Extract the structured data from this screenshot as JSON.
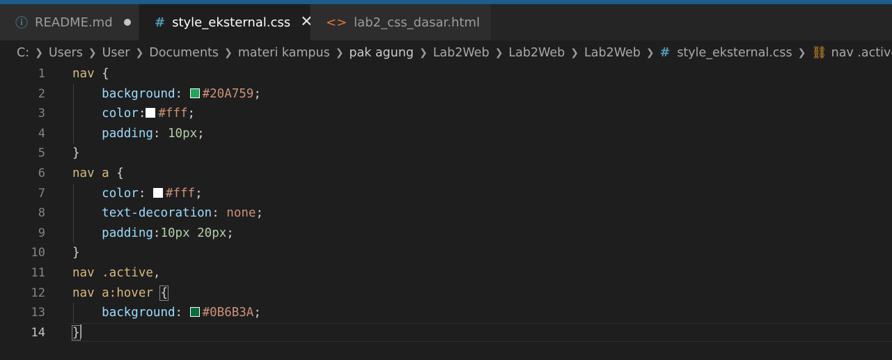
{
  "tabs": [
    {
      "label": "README.md",
      "icon": "info-icon",
      "modified": true,
      "active": false
    },
    {
      "label": "style_eksternal.css",
      "icon": "css-hash-icon",
      "active": true
    },
    {
      "label": "lab2_css_dasar.html",
      "icon": "html-code-icon",
      "active": false
    }
  ],
  "breadcrumb": [
    "C:",
    "Users",
    "User",
    "Documents",
    "materi kampus",
    "pak agung",
    "Lab2Web",
    "Lab2Web",
    "Lab2Web",
    "style_eksternal.css",
    "nav .active"
  ],
  "colors": {
    "swatch_green": "#20A759",
    "swatch_white": "#ffffff",
    "swatch_dark_green": "#0B6B3A",
    "accent_strip": "#1c5d8c"
  },
  "code": {
    "line_numbers": [
      "1",
      "2",
      "3",
      "4",
      "5",
      "6",
      "7",
      "8",
      "9",
      "10",
      "11",
      "12",
      "13",
      "14"
    ],
    "l1_sel": "nav",
    "l1_brace": " {",
    "l2_prop": "background",
    "l2_colon": ": ",
    "l2_val": "#20A759",
    "l2_semi": ";",
    "l3_prop": "color",
    "l3_colon": ":",
    "l3_val": "#fff",
    "l3_semi": ";",
    "l4_prop": "padding",
    "l4_colon": ": ",
    "l4_val": "10px",
    "l4_semi": ";",
    "l5_brace": "}",
    "l6_sel": "nav a",
    "l6_brace": " {",
    "l7_prop": "color",
    "l7_colon": ": ",
    "l7_val": "#fff",
    "l7_semi": ";",
    "l8_prop": "text-decoration",
    "l8_colon": ": ",
    "l8_val": "none",
    "l8_semi": ";",
    "l9_prop": "padding",
    "l9_colon": ":",
    "l9_val": "10px 20px",
    "l9_semi": ";",
    "l10_brace": "}",
    "l11_sel": "nav .active",
    "l11_comma": ",",
    "l12_sel": "nav a:hover",
    "l12_brace": "{",
    "l13_prop": "background",
    "l13_colon": ": ",
    "l13_val": "#0B6B3A",
    "l13_semi": ";",
    "l14_brace": "}"
  }
}
